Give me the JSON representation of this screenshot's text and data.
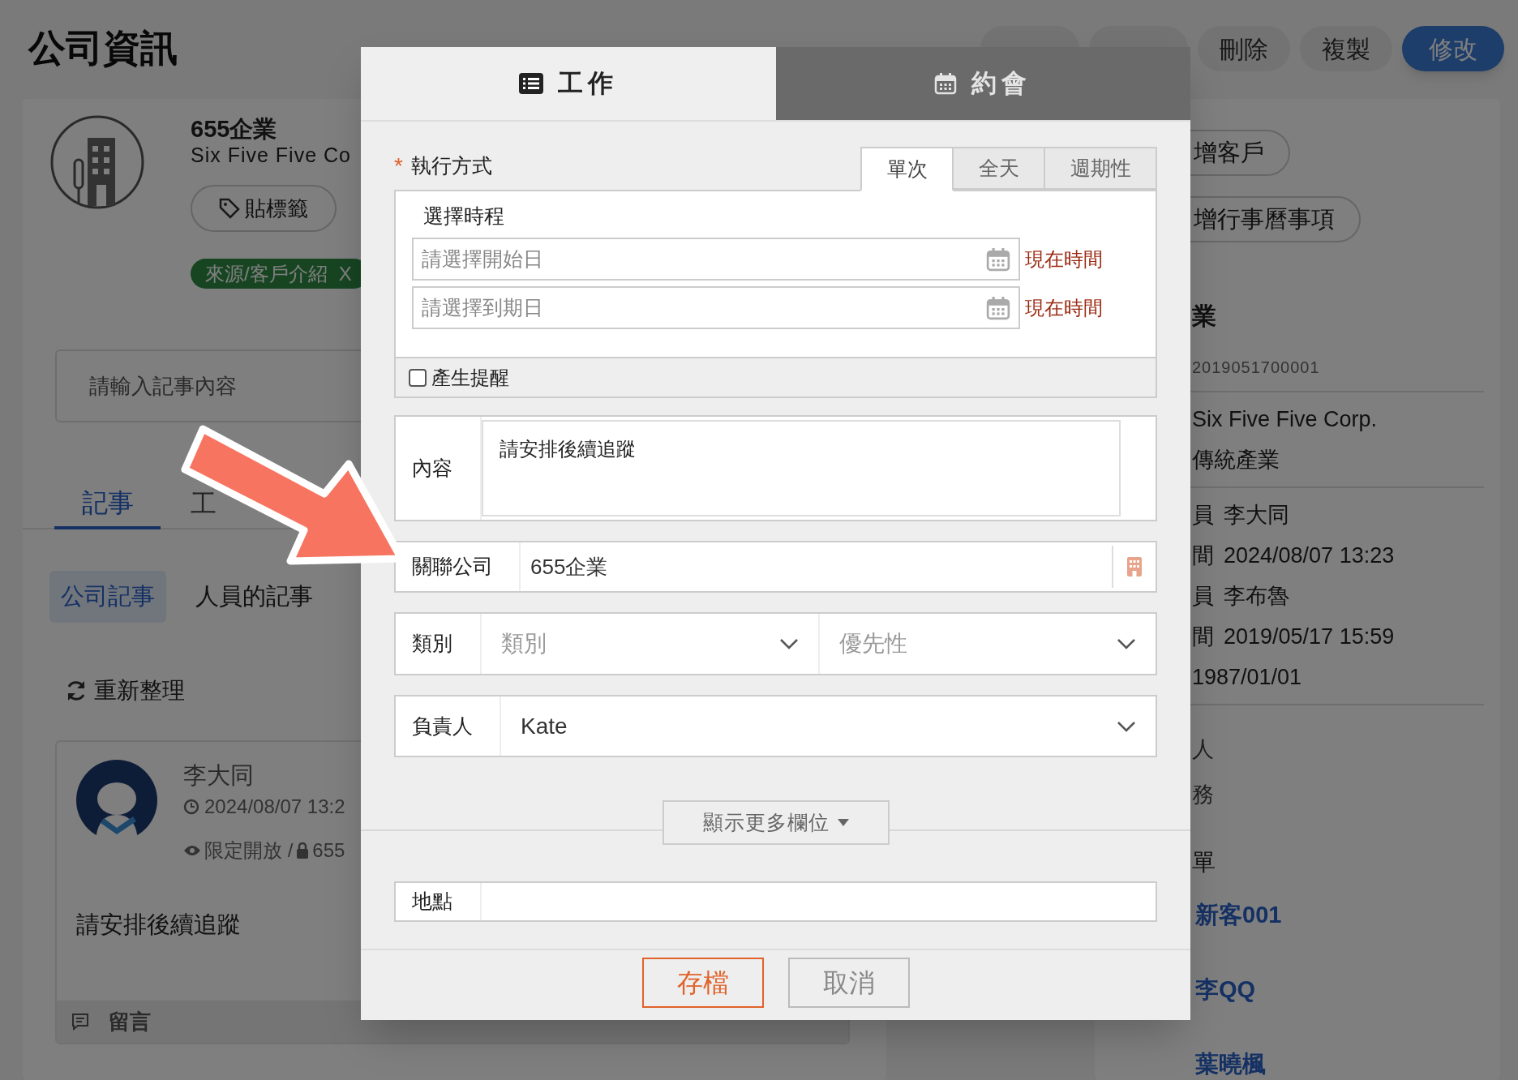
{
  "header": {
    "title": "公司資訊",
    "buttons": [
      {
        "kind": "covered"
      },
      {
        "kind": "covered"
      },
      {
        "kind": "plain",
        "label": "刪除"
      },
      {
        "kind": "plain",
        "label": "複製"
      },
      {
        "kind": "primary",
        "label": "修改"
      }
    ]
  },
  "company": {
    "name": "655企業",
    "name_en": "Six Five Five Co",
    "tag_button": "貼標籤",
    "source_tag": {
      "label": "來源/客戶介紹",
      "remove": "X"
    }
  },
  "note_input": {
    "placeholder": "請輸入記事內容"
  },
  "tabs": [
    {
      "label": "記事",
      "selected": true
    },
    {
      "label": "工",
      "selected": false
    }
  ],
  "sub_tabs": [
    {
      "label": "公司記事",
      "selected": true
    },
    {
      "label": "人員的記事",
      "selected": false
    }
  ],
  "refresh": "重新整理",
  "note": {
    "author": "李大同",
    "time": "2024/08/07 13:2",
    "visibility": "限定開放 /",
    "company": "655",
    "content": "請安排後續追蹤",
    "comment": "留言"
  },
  "side": {
    "buttons": [
      "增客戶",
      "增行事曆事項"
    ],
    "title": "業",
    "code": "2019051700001",
    "sections": [
      {
        "lines": [
          {
            "value": "Six Five Five Corp."
          },
          {
            "value": "傳統產業"
          }
        ]
      },
      {
        "lines": [
          {
            "label": "員",
            "value": "李大同"
          },
          {
            "label": "間",
            "value": "2024/08/07 13:23"
          },
          {
            "label": "員",
            "value": "李布魯"
          },
          {
            "label": "間",
            "value": "2019/05/17 15:59"
          },
          {
            "value": "1987/01/01"
          }
        ]
      }
    ],
    "fragments": [
      "人",
      "務"
    ],
    "list_title": "單",
    "links": [
      "新客001",
      "李QQ",
      "葉曉楓"
    ]
  },
  "dialog": {
    "tabs": [
      {
        "label": "工作",
        "selected": true
      },
      {
        "label": "約會",
        "selected": false
      }
    ],
    "mode": {
      "label": "執行方式",
      "required_mark": "*",
      "options": [
        {
          "label": "單次",
          "selected": true
        },
        {
          "label": "全天",
          "selected": false
        },
        {
          "label": "週期性",
          "selected": false
        }
      ]
    },
    "schedule": {
      "title": "選擇時程",
      "dates": [
        {
          "placeholder": "請選擇開始日",
          "now": "現在時間"
        },
        {
          "placeholder": "請選擇到期日",
          "now": "現在時間"
        }
      ]
    },
    "reminder": {
      "label": "產生提醒",
      "checked": false
    },
    "fields": [
      {
        "kind": "textarea",
        "label": "內容",
        "value": "請安排後續追蹤"
      },
      {
        "kind": "lookup",
        "label": "關聯公司",
        "value": "655企業"
      },
      {
        "kind": "selects",
        "label": "類別",
        "selects": [
          {
            "placeholder": "類別"
          },
          {
            "placeholder": "優先性"
          }
        ]
      },
      {
        "kind": "select",
        "label": "負責人",
        "value": "Kate"
      }
    ],
    "more_button": "顯示更多欄位",
    "location": {
      "label": "地點"
    },
    "buttons": [
      {
        "label": "存檔",
        "kind": "primary"
      },
      {
        "label": "取消",
        "kind": "secondary"
      }
    ]
  }
}
